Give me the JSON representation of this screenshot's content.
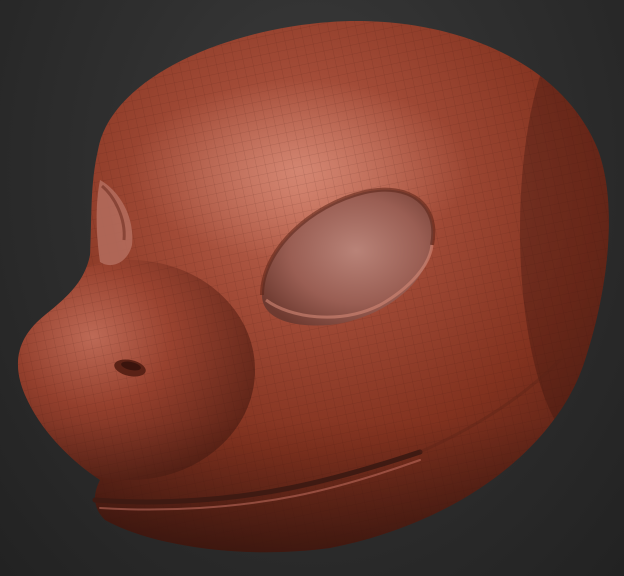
{
  "viewport": {
    "background_color": "#2e2e2e",
    "subject": "sculpted-creature-head"
  },
  "model": {
    "material_base_color": "#8e3c2c",
    "material_highlight_color": "#c7735f",
    "material_shadow_color": "#3f1a12",
    "eye_socket_color": "#9a5e53",
    "wireframe_visible": true
  }
}
